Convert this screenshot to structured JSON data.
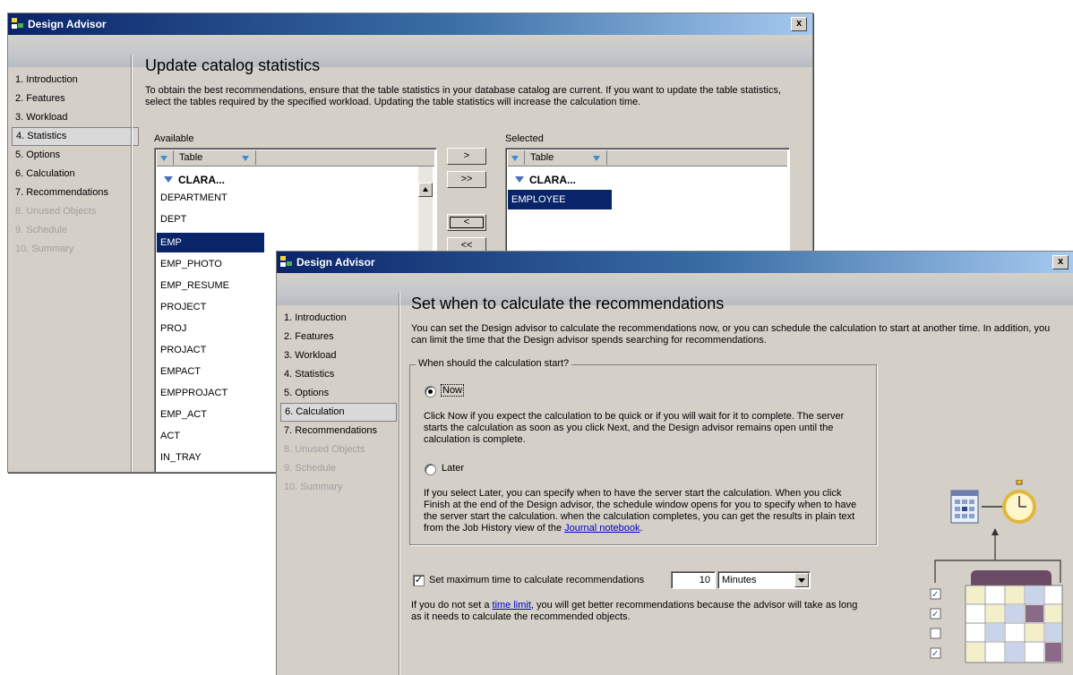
{
  "window_back": {
    "title": "Design Advisor",
    "close_glyph": "x",
    "nav": [
      {
        "label": "1. Introduction",
        "state": "normal"
      },
      {
        "label": "2. Features",
        "state": "normal"
      },
      {
        "label": "3. Workload",
        "state": "normal"
      },
      {
        "label": "4. Statistics",
        "state": "selected"
      },
      {
        "label": "5. Options",
        "state": "normal"
      },
      {
        "label": "6. Calculation",
        "state": "normal"
      },
      {
        "label": "7. Recommendations",
        "state": "normal"
      },
      {
        "label": "8. Unused Objects",
        "state": "disabled"
      },
      {
        "label": "9. Schedule",
        "state": "disabled"
      },
      {
        "label": "10. Summary",
        "state": "disabled"
      }
    ],
    "heading": "Update catalog statistics",
    "description": "To obtain the best recommendations, ensure that the table statistics in your database catalog are current. If you want to update the table statistics, select the tables required by the specified workload. Updating the table statistics will increase the calculation time.",
    "available": {
      "label": "Available",
      "column": "Table",
      "group": "CLARA...",
      "rows": [
        "DEPARTMENT",
        "DEPT",
        "EMP",
        "EMP_PHOTO",
        "EMP_RESUME",
        "PROJECT",
        "PROJ",
        "PROJACT",
        "EMPACT",
        "EMPPROJACT",
        "EMP_ACT",
        "ACT",
        "IN_TRAY"
      ],
      "selected_row": "EMP"
    },
    "move_buttons": [
      ">",
      ">>",
      "<",
      "<<"
    ],
    "selected": {
      "label": "Selected",
      "column": "Table",
      "group": "CLARA...",
      "rows": [
        "EMPLOYEE"
      ]
    }
  },
  "window_front": {
    "title": "Design Advisor",
    "close_glyph": "x",
    "nav": [
      {
        "label": "1. Introduction",
        "state": "normal"
      },
      {
        "label": "2. Features",
        "state": "normal"
      },
      {
        "label": "3. Workload",
        "state": "normal"
      },
      {
        "label": "4. Statistics",
        "state": "normal"
      },
      {
        "label": "5. Options",
        "state": "normal"
      },
      {
        "label": "6. Calculation",
        "state": "selected"
      },
      {
        "label": "7. Recommendations",
        "state": "normal"
      },
      {
        "label": "8. Unused Objects",
        "state": "disabled"
      },
      {
        "label": "9. Schedule",
        "state": "disabled"
      },
      {
        "label": "10. Summary",
        "state": "disabled"
      }
    ],
    "heading": "Set when to calculate the recommendations",
    "description": "You can set the Design advisor to calculate the recommendations now, or you can schedule the calculation to start at another time. In addition, you can limit the time that the Design advisor spends searching for recommendations.",
    "group_title": "When should the calculation start?",
    "now": {
      "label": "Now",
      "selected": true,
      "description": "Click Now if you expect the calculation to be quick or if you will wait for it to complete. The server starts the calculation as soon as you click Next, and the Design advisor remains open until the calculation is complete."
    },
    "later": {
      "label": "Later",
      "selected": false,
      "description_before_link": "If you select Later, you can specify when to have the server start the calculation. When you click Finish at the end of the Design advisor, the schedule window opens for you to specify when to have the server start the calculation. when the calculation completes, you can get the results in plain text from the Job History view of the ",
      "link": "Journal notebook",
      "description_after_link": "."
    },
    "max_time": {
      "checked": true,
      "check_glyph": "✓",
      "label": "Set maximum time to calculate recommendations",
      "value": "10",
      "unit": "Minutes"
    },
    "note_before_link": "If you do not set a ",
    "note_link": "time limit",
    "note_after_link": ", you will get better recommendations because the advisor will take as long as it needs to calculate the recommended objects.",
    "illustration_checks": [
      "✓",
      "✓",
      "",
      "✓"
    ],
    "colors": {
      "title_dark": "#0a246a",
      "title_light": "#a6caf0",
      "selection": "#0a246a",
      "link": "#0000cc",
      "calendar_header": "#6b4a66",
      "calendar_cell": "#f3efc9",
      "calendar_blue": "#c9d3ea"
    }
  }
}
